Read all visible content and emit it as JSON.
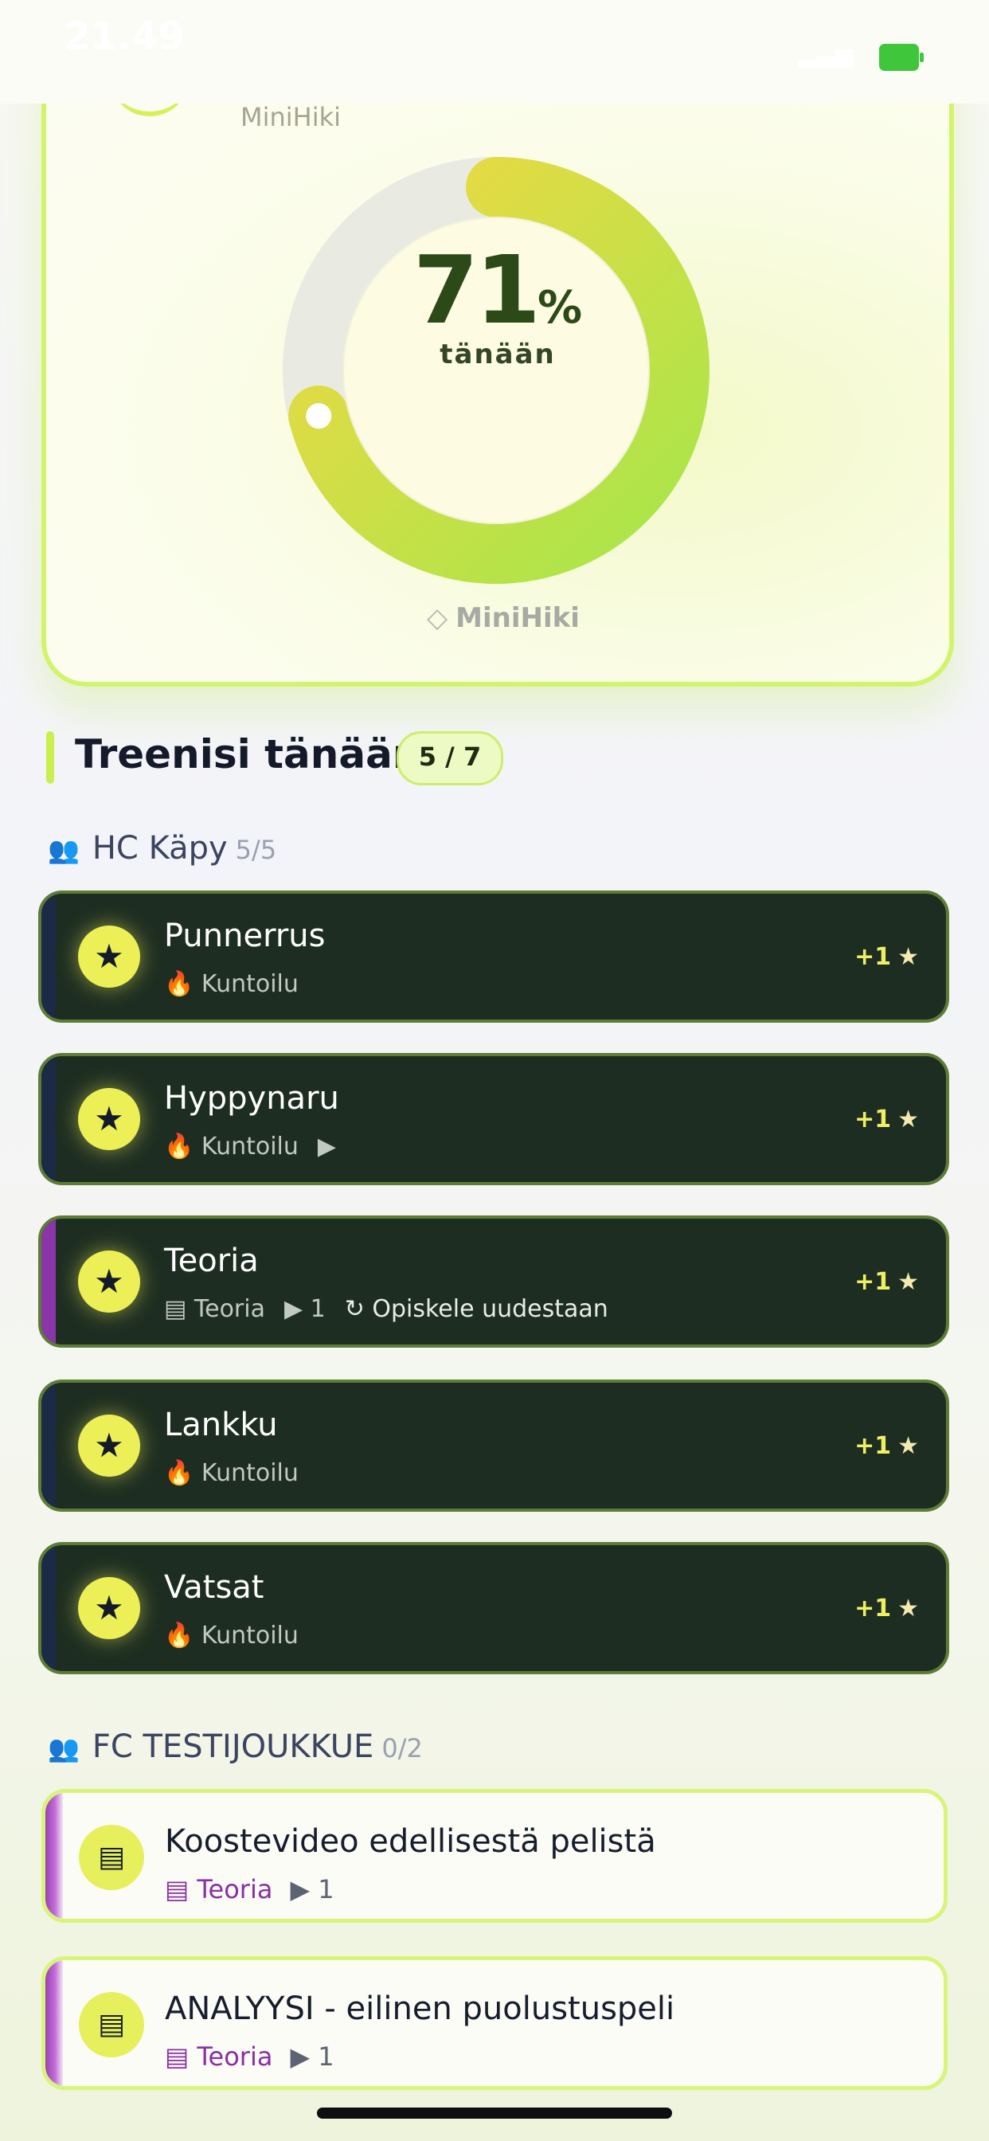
{
  "status_bar": {
    "time": "21.49",
    "moon": "☾"
  },
  "hero": {
    "brand_top": "MiniHiki",
    "percent": "71",
    "percent_symbol": "%",
    "percent_label": "tänään",
    "progress_fraction": 0.71,
    "brand": "MiniHiki",
    "colors": {
      "ring_start": "#a7e64a",
      "ring_end": "#f2d843",
      "track": "#e9ebe2"
    }
  },
  "section": {
    "title": "Treenisi tänään",
    "count": "5 / 7"
  },
  "groups": [
    {
      "name": "HC Käpy",
      "count": "5/5",
      "items": [
        {
          "title": "Punnerrus",
          "meta": [
            "🔥 Kuntoilu"
          ],
          "reward": "+1",
          "strip": "blue"
        },
        {
          "title": "Hyppynaru",
          "meta": [
            "🔥 Kuntoilu",
            "▶"
          ],
          "reward": "+1",
          "strip": "blue"
        },
        {
          "title": "Teoria",
          "meta": [
            "▤ Teoria",
            "▶ 1",
            "↻ Opiskele uudestaan"
          ],
          "reward": "+1",
          "strip": "purple"
        },
        {
          "title": "Lankku",
          "meta": [
            "🔥 Kuntoilu"
          ],
          "reward": "+1",
          "strip": "blue"
        },
        {
          "title": "Vatsat",
          "meta": [
            "🔥 Kuntoilu"
          ],
          "reward": "+1",
          "strip": "blue"
        }
      ]
    },
    {
      "name": "FC TESTIJOUKKUE",
      "count": "0/2",
      "items": [
        {
          "title": "Koostevideo edellisestä pelistä",
          "type": "Teoria",
          "count": "1"
        },
        {
          "title": "ANALYYSI - eilinen puolustuspeli",
          "type": "Teoria",
          "count": "1"
        }
      ]
    }
  ]
}
